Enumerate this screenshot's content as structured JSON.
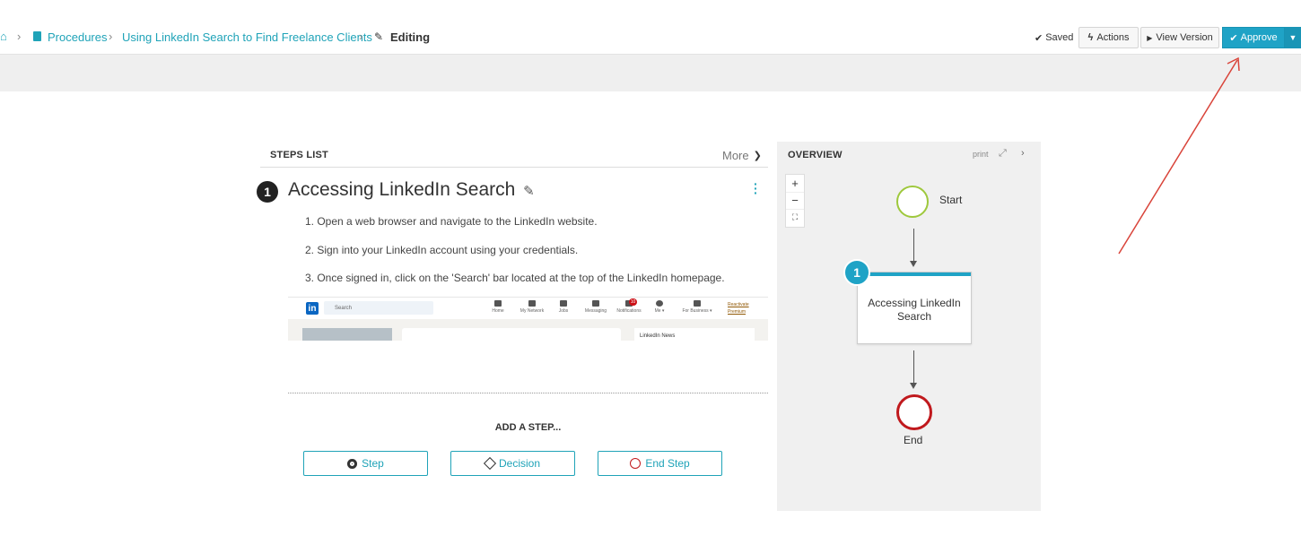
{
  "breadcrumb": {
    "items": [
      "Procedures",
      "Using LinkedIn Search to Find Freelance Clients"
    ],
    "current": "Editing"
  },
  "toolbar": {
    "saved_label": "Saved",
    "actions_label": "Actions",
    "view_version_label": "View Version",
    "approve_label": "Approve"
  },
  "steps_list": {
    "title": "STEPS LIST",
    "more_label": "More",
    "step": {
      "number": "1",
      "title": "Accessing LinkedIn Search",
      "instructions": [
        "1. Open a web browser and navigate to the LinkedIn website.",
        "2. Sign into your LinkedIn account using your credentials.",
        "3. Once signed in, click on the 'Search' bar located at the top of the LinkedIn homepage."
      ],
      "screenshot": {
        "logo": "in",
        "search_placeholder": "Search",
        "nav": [
          "Home",
          "My Network",
          "Jobs",
          "Messaging",
          "Notifications",
          "Me ▾",
          "For Business ▾"
        ],
        "notification_count": "10",
        "premium": [
          "Reactivate",
          "Premium"
        ],
        "news_label": "LinkedIn News"
      }
    },
    "add_step_label": "ADD A STEP...",
    "buttons": {
      "step": "Step",
      "decision": "Decision",
      "end_step": "End Step"
    }
  },
  "overview": {
    "title": "OVERVIEW",
    "print_label": "print",
    "zoom": [
      "+",
      "−",
      "⛶"
    ],
    "start_label": "Start",
    "task_number": "1",
    "task_label": "Accessing LinkedIn Search",
    "end_label": "End"
  },
  "colors": {
    "accent": "#1fa3c6",
    "start": "#9ec83c",
    "end": "#c0191d",
    "annotation_arrow": "#d9443a"
  }
}
